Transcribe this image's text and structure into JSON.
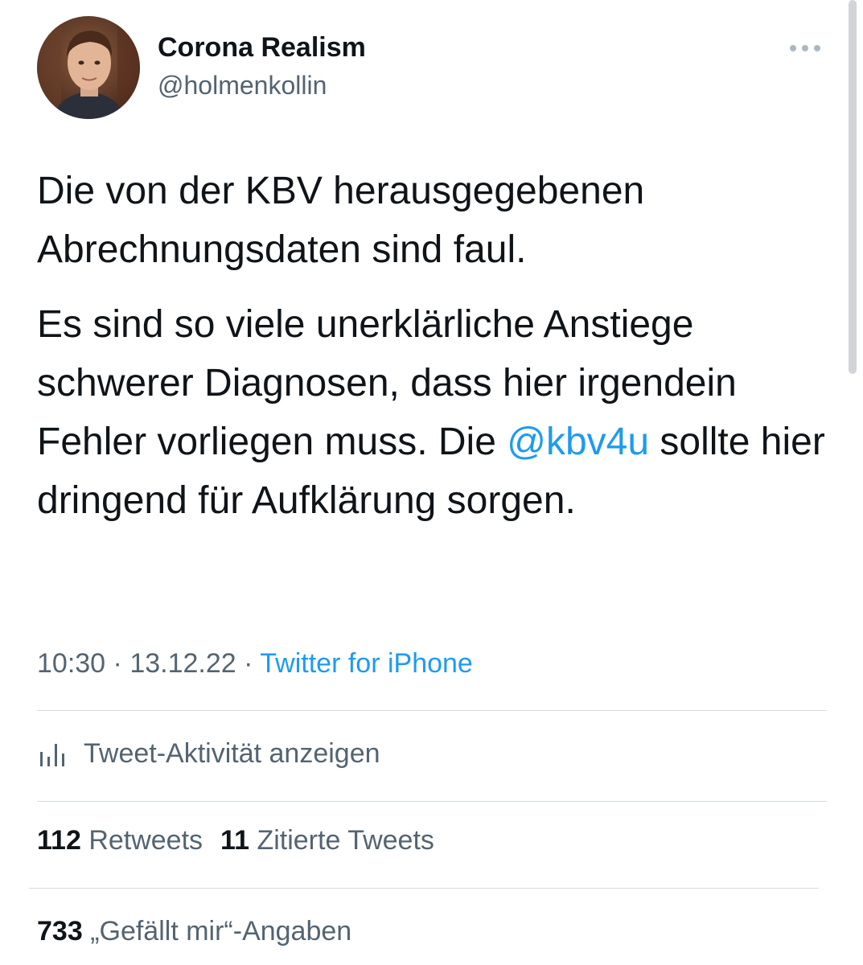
{
  "user": {
    "display_name": "Corona Realism",
    "handle": "@holmenkollin"
  },
  "tweet": {
    "paragraph1": "Die von der KBV herausgegebenen Abrechnungsdaten sind faul.",
    "paragraph2_part1": "Es sind so viele unerklärliche Anstiege schwerer Diagnosen, dass hier irgendein Fehler vorliegen muss. Die ",
    "mention": "@kbv4u",
    "paragraph2_part2": " sollte hier dringend für Aufklärung sorgen."
  },
  "meta": {
    "time": "10:30",
    "separator": " · ",
    "date": "13.12.22",
    "source": "Twitter for iPhone"
  },
  "activity": {
    "label": "Tweet-Aktivität anzeigen",
    "icon": "bar-chart-icon"
  },
  "stats": {
    "retweets_count": "112",
    "retweets_label": "Retweets",
    "quotes_count": "11",
    "quotes_label": "Zitierte Tweets",
    "likes_count": "733",
    "likes_label": "„Gefällt mir“-Angaben"
  },
  "icons": {
    "more": "more-dots-icon"
  },
  "colors": {
    "link": "#1d9bf0",
    "text": "#0f1419",
    "secondary": "#536471",
    "divider": "#d7dbdf"
  }
}
